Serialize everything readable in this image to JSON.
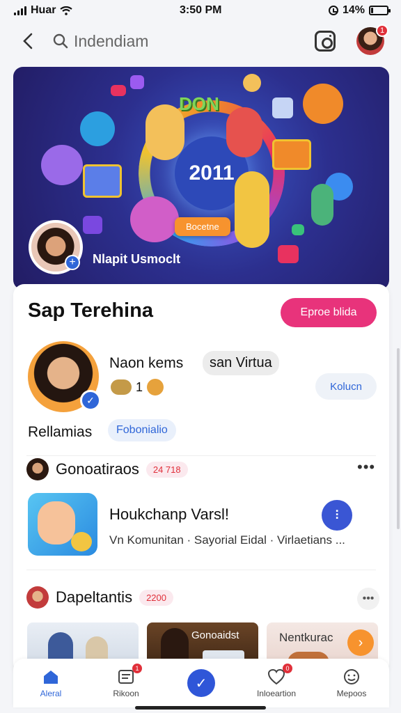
{
  "status_bar": {
    "carrier": "Huar",
    "time": "3:50 PM",
    "battery": "14%",
    "battery_level": 0.14
  },
  "top_nav": {
    "search_text": "Indendiam",
    "notification_count": "1"
  },
  "banner": {
    "center_number": "2011",
    "badge_text": "DON",
    "button_label": "Bocetne",
    "profile_name": "Nlapit Usmoclt"
  },
  "profile_card": {
    "title": "Sap Terehina",
    "follow_label": "Eproe blida",
    "user_name": "Naon kems",
    "virtual_chip": "san Virtua",
    "emoji_count": "1",
    "kolum_label": "Kolucn",
    "relation_label": "Rellamias",
    "relation_chip": "Fobonialio"
  },
  "section_connections": {
    "title": "Gonoatiraos",
    "count": "24 718"
  },
  "group": {
    "title": "Houkchanp Varsl!",
    "meta": "Vn Komunitan · Sayorial Eidal · Virlaetians ..."
  },
  "section_deals": {
    "title": "Dapeltantis",
    "count": "2200"
  },
  "thumbnails": [
    {
      "label": ""
    },
    {
      "label": "Gonoaidst"
    },
    {
      "label": "Nentkurac"
    }
  ],
  "bottom_nav": [
    {
      "label": "Aleral",
      "icon": "home-icon",
      "active": true
    },
    {
      "label": "Rikoon",
      "icon": "document-icon",
      "badge": "1"
    },
    {
      "label": "",
      "icon": "create-icon"
    },
    {
      "label": "Inloeartion",
      "icon": "heart-shield-icon",
      "badge": "0"
    },
    {
      "label": "Mepoos",
      "icon": "smile-chat-icon"
    }
  ],
  "colors": {
    "accent_blue": "#2f66d8",
    "accent_pink": "#e8337b",
    "badge_red": "#e0303a",
    "banner_orange": "#f7932e"
  }
}
